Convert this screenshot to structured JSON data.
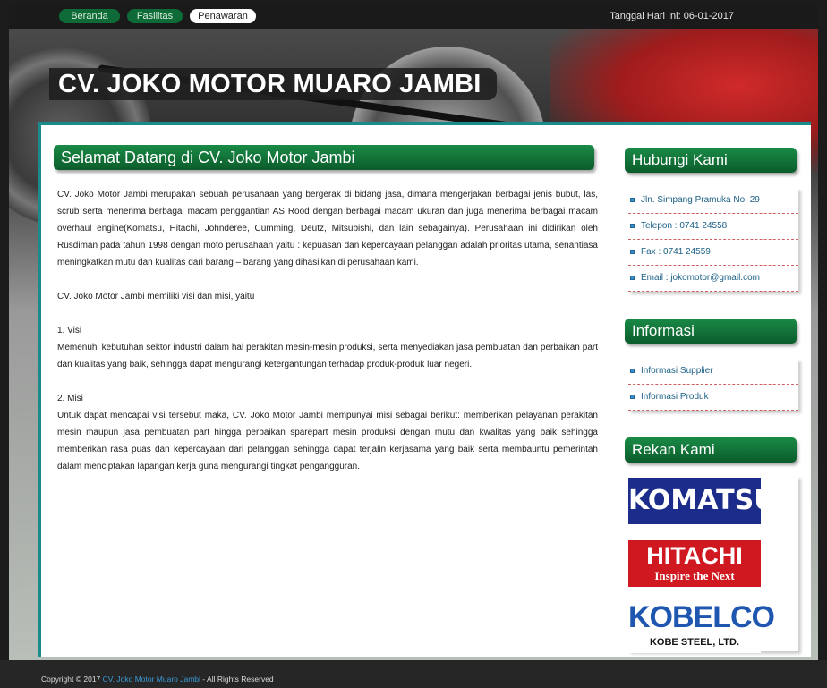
{
  "nav": {
    "items": [
      {
        "label": "Beranda"
      },
      {
        "label": "Fasilitas"
      },
      {
        "label": "Penawaran"
      }
    ],
    "date_label": "Tanggal Hari Ini: 06-01-2017"
  },
  "banner": {
    "title": "CV. JOKO MOTOR MUARO JAMBI"
  },
  "main": {
    "heading": "Selamat Datang di CV. Joko Motor Jambi",
    "intro": "CV. Joko Motor Jambi merupakan sebuah perusahaan yang bergerak di bidang jasa, dimana mengerjakan berbagai jenis bubut, las, scrub serta menerima berbagai macam penggantian AS Rood dengan berbagai macam ukuran dan juga menerima berbagai macam overhaul engine(Komatsu, Hitachi, Johnderee, Cumming, Deutz, Mitsubishi, dan lain sebagainya). Perusahaan ini didirikan oleh Rusdiman pada tahun 1998 dengan moto perusahaan yaitu : kepuasan dan kepercayaan pelanggan adalah prioritas utama, senantiasa meningkatkan mutu dan kualitas dari barang – barang yang dihasilkan di perusahaan kami.",
    "visi_misi_intro": "CV. Joko Motor Jambi memiliki visi dan misi, yaitu",
    "visi_title": "1. Visi",
    "visi_text": "Memenuhi kebutuhan sektor industri dalam hal perakitan mesin-mesin produksi, serta menyediakan jasa pembuatan dan perbaikan part dan kualitas yang baik, sehingga dapat mengurangi ketergantungan terhadap produk-produk luar negeri.",
    "misi_title": "2. Misi",
    "misi_text": "Untuk dapat mencapai visi tersebut maka, CV. Joko Motor Jambi mempunyai misi sebagai berikut: memberikan pelayanan perakitan mesin maupun jasa pembuatan part hingga perbaikan sparepart mesin produksi dengan mutu dan kwalitas yang baik sehingga memberikan rasa puas dan kepercayaan dari pelanggan sehingga dapat terjalin kerjasama yang baik serta membauntu pemerintah dalam menciptakan lapangan kerja guna mengurangi tingkat pengangguran."
  },
  "sidebar": {
    "contact": {
      "heading": "Hubungi Kami",
      "items": [
        {
          "label": "Jln. Simpang Pramuka No. 29"
        },
        {
          "label": "Telepon : 0741 24558"
        },
        {
          "label": "Fax : 0741 24559"
        },
        {
          "label": "Email : jokomotor@gmail.com"
        }
      ]
    },
    "info": {
      "heading": "Informasi",
      "items": [
        {
          "label": "Informasi Supplier"
        },
        {
          "label": "Informasi Produk"
        }
      ]
    },
    "partners": {
      "heading": "Rekan Kami",
      "logos": [
        {
          "text": "KOMATSU"
        },
        {
          "text": "HITACHI",
          "tagline": "Inspire the Next"
        },
        {
          "text": "KOBELCO",
          "tagline": "KOBE STEEL, LTD."
        }
      ]
    }
  },
  "footer": {
    "prefix": "Copyright © 2017 ",
    "link": "CV. Joko Motor Muaro Jambi",
    "suffix": " - All Rights Reserved"
  },
  "colors": {
    "heading_green": "#0e6a36",
    "content_border": "#1b8a8a",
    "link_blue": "#1a5f86"
  }
}
